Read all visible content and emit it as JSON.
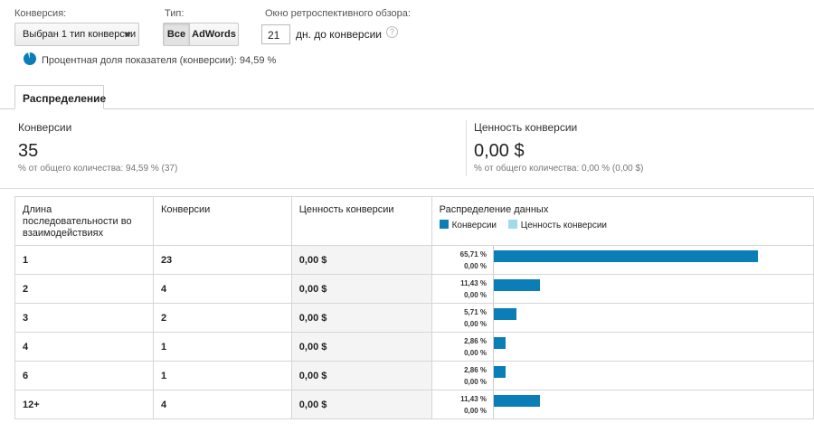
{
  "controls": {
    "conversion_label": "Конверсия:",
    "conversion_selected": "Выбран 1 тип конверсии",
    "type_label": "Тип:",
    "type_options": [
      "Все",
      "AdWords"
    ],
    "lookback_label": "Окно ретроспективного обзора:",
    "lookback_value": "21",
    "lookback_unit": "дн. до конверсии",
    "help_glyph": "?"
  },
  "share": {
    "text": "Процентная доля показателя (конверсии): 94,59 %",
    "percent": 94.59
  },
  "tab": {
    "label": "Распределение"
  },
  "metrics": [
    {
      "title": "Конверсии",
      "value": "35",
      "sub": "% от общего количества: 94,59 % (37)"
    },
    {
      "title": "Ценность конверсии",
      "value": "0,00 $",
      "sub": "% от общего количества: 0,00 % (0,00 $)"
    }
  ],
  "table": {
    "headers": [
      "Длина последовательности во взаимодействиях",
      "Конверсии",
      "Ценность конверсии",
      "Распределение данных"
    ],
    "legend": [
      "Конверсии",
      "Ценность конверсии"
    ],
    "rows": [
      {
        "length": "1",
        "conversions": "23",
        "value": "0,00 $",
        "pct_conv": "65,71 %",
        "pct_value": "0,00 %",
        "share": 65.71
      },
      {
        "length": "2",
        "conversions": "4",
        "value": "0,00 $",
        "pct_conv": "11,43 %",
        "pct_value": "0,00 %",
        "share": 11.43
      },
      {
        "length": "3",
        "conversions": "2",
        "value": "0,00 $",
        "pct_conv": "5,71 %",
        "pct_value": "0,00 %",
        "share": 5.71
      },
      {
        "length": "4",
        "conversions": "1",
        "value": "0,00 $",
        "pct_conv": "2,86 %",
        "pct_value": "0,00 %",
        "share": 2.86
      },
      {
        "length": "6",
        "conversions": "1",
        "value": "0,00 $",
        "pct_conv": "2,86 %",
        "pct_value": "0,00 %",
        "share": 2.86
      },
      {
        "length": "12+",
        "conversions": "4",
        "value": "0,00 $",
        "pct_conv": "11,43 %",
        "pct_value": "0,00 %",
        "share": 11.43
      }
    ]
  },
  "colors": {
    "conversions": "#0b7eb8",
    "conversion_value": "#9fdbea"
  }
}
